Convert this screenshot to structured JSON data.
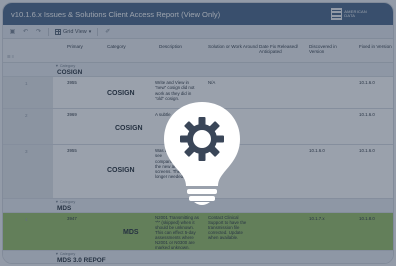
{
  "window": {
    "title": "v10.1.6.x Issues & Solutions Client Access Report (View Only)",
    "logo_lines": [
      "AMERICAN",
      "DATA"
    ]
  },
  "toolbar": {
    "grid_view_label": "Grid View",
    "icons": [
      "save-icon",
      "undo-icon",
      "redo-icon",
      "grid-view-icon",
      "chevron-down-icon",
      "highlighter-icon"
    ]
  },
  "columns": {
    "primary": "Primary",
    "category": "Category",
    "description": "Description",
    "solution": "Solution or Work Around",
    "date_fix": "Date Fix Released/ Anticipated",
    "discovered": "Discovered in Version",
    "fixed": "Fixed in Version",
    "gutter_hint": "☰ ≡"
  },
  "groups": [
    {
      "caption": "▼ Category",
      "label": "COSIGN",
      "rows": [
        {
          "num": "1",
          "primary": "3955",
          "category": "COSIGN",
          "description": [
            "Write and View in",
            "\"new\" cosign did not",
            "work as they did in",
            "\"old\" cosign."
          ],
          "solution": "N/A",
          "discovered": "",
          "fixed": "10.1.6.0"
        },
        {
          "num": "2",
          "primary": "3969",
          "category": "COSIGN",
          "description": [
            "A subtle"
          ],
          "solution": "",
          "discovered": "",
          "fixed": "10.1.6.0"
        },
        {
          "num": "3",
          "primary": "3955",
          "category": "COSIGN",
          "description": [
            "Was a",
            "see",
            "",
            "comparison between",
            "the new and old cosign",
            "screens. They no",
            "longer needed."
          ],
          "solution": "",
          "discovered": "10.1.6.0",
          "fixed": "10.1.6.0"
        }
      ]
    },
    {
      "caption": "▼ Category",
      "label": "MDS",
      "rows": [
        {
          "num": "4",
          "primary": "3947",
          "category": "MDS",
          "description": [
            "N2001 Transmitting as",
            "\"^\" (skipped) when it",
            "should be unknown.",
            "This can effect 5-day",
            "assessments where",
            "N2001 or N0300 are",
            "marked unknown."
          ],
          "solution": [
            "Contact Clinical",
            "Support to have the",
            "transmission file",
            "corrected. Update",
            "when available."
          ],
          "discovered": "10.1.7.x",
          "fixed": "10.1.8.0"
        }
      ]
    },
    {
      "caption": "▼ Category",
      "label": "MDS 3.0 REPOF"
    }
  ],
  "overlay_icon": "lightbulb-gear-icon",
  "colors": {
    "titlebar": "#4f6b8c",
    "overlay": "#1e2e46",
    "highlight_row": "#9cc26a"
  }
}
